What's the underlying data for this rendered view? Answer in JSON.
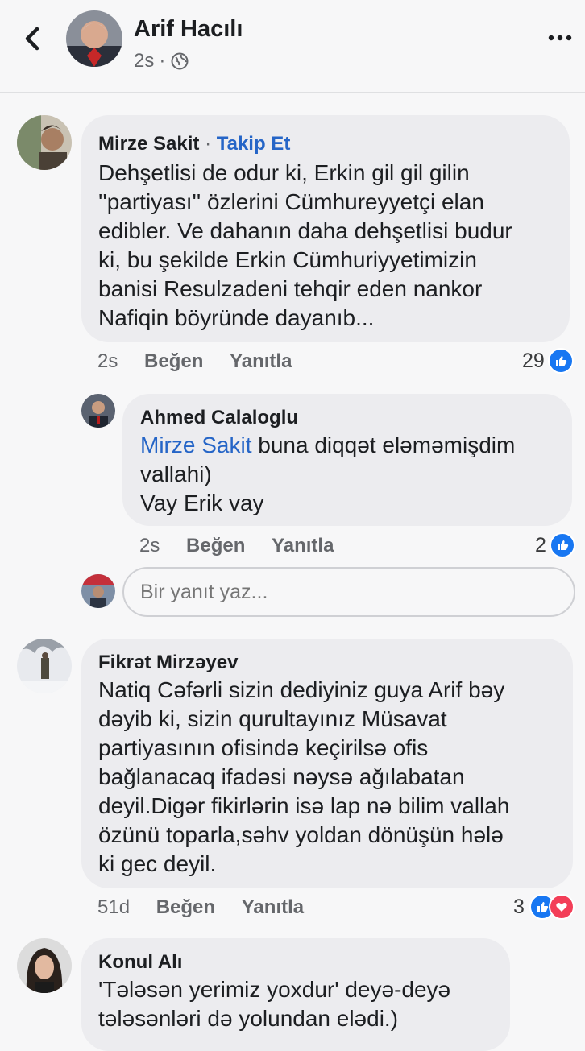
{
  "header": {
    "title": "Arif Hacılı",
    "time": "2s",
    "dot": "·"
  },
  "comments": [
    {
      "author": "Mirze Sakit",
      "separator": "·",
      "follow": "Takip Et",
      "lines": [
        "Dehşetlisi de odur ki, Erkin gil gil gilin",
        "''partiyası'' özlerini Cümhureyyetçi elan",
        "edibler. Ve dahanın daha dehşetlisi budur",
        "ki, bu şekilde Erkin Cümhuriyyetimizin",
        "banisi Resulzadeni tehqir eden nankor",
        "Nafiqin böyründe dayanıb..."
      ],
      "time": "2s",
      "like": "Beğen",
      "reply": "Yanıtla",
      "reactions": "29"
    },
    {
      "author": "Ahmed Calaloglu",
      "mention": "Mirze Sakit",
      "line1_rest": " buna diqqət eləməmişdim",
      "line2": "vallahi)",
      "line3": "Vay Erik vay",
      "time": "2s",
      "like": "Beğen",
      "reply": "Yanıtla",
      "reactions": "2"
    },
    {
      "author": "Fikrət Mirzəyev",
      "lines": [
        "Natiq Cəfərli sizin dediyiniz guya  Arif bəy",
        "dəyib ki, sizin qurultayınız Müsavat",
        "partiyasının ofisində keçirilsə ofis",
        "bağlanacaq ifadəsi nəysə ağılabatan",
        "deyil.Digər fikirlərin isə lap nə bilim vallah",
        "özünü toparla,səhv yoldan dönüşün hələ",
        "ki gec deyil."
      ],
      "time": "51d",
      "like": "Beğen",
      "reply": "Yanıtla",
      "reactions": "3"
    },
    {
      "author": "Konul Alı",
      "lines": [
        "'Tələsən yerimiz yoxdur' deyə-deyə",
        "tələsənləri də yolundan elədi.)"
      ]
    }
  ],
  "reply_input": {
    "placeholder": "Bir yanıt yaz..."
  },
  "colors": {
    "link": "#2565c7",
    "like": "#1877f2",
    "love": "#f33e58",
    "bubble": "#ececef"
  }
}
